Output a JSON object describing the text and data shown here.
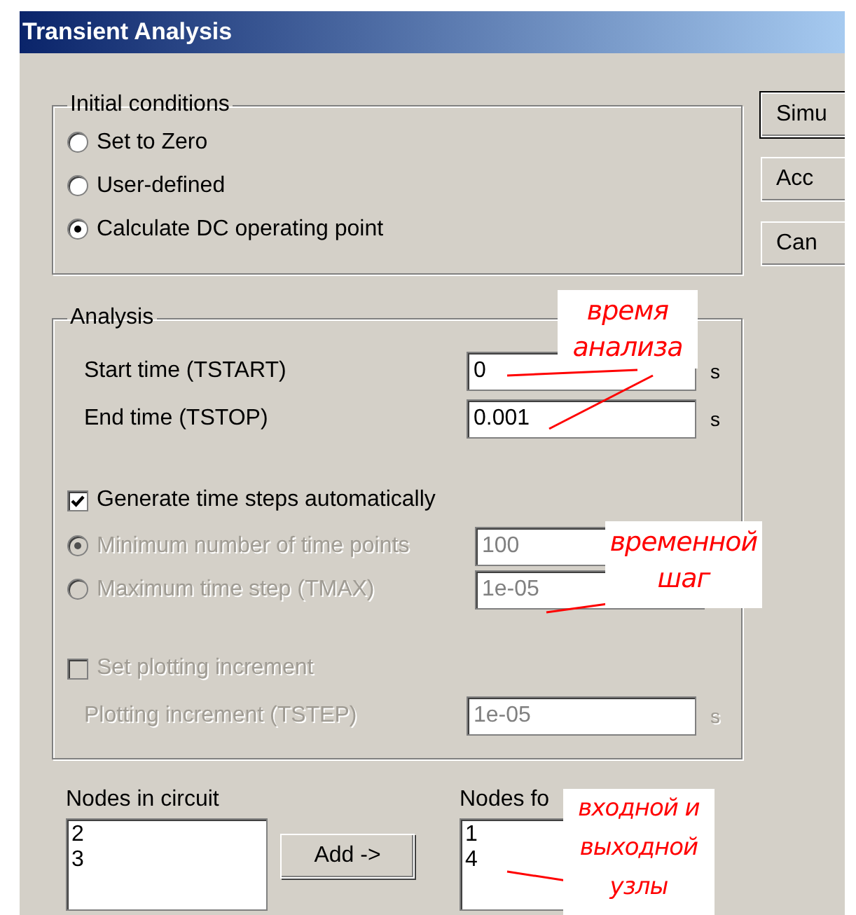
{
  "window": {
    "title": "Transient Analysis"
  },
  "initial_conditions": {
    "title": "Initial conditions",
    "options": [
      {
        "label": "Set to Zero",
        "selected": false
      },
      {
        "label": "User-defined",
        "selected": false
      },
      {
        "label": "Calculate DC operating point",
        "selected": true
      }
    ]
  },
  "buttons": [
    "Simu",
    "Acc",
    "Can"
  ],
  "analysis": {
    "title": "Analysis",
    "rows": [
      {
        "kind": "field",
        "label": "Start time (TSTART)",
        "value": "0",
        "unit": "s",
        "disabled": false
      },
      {
        "kind": "field",
        "label": "End time (TSTOP)",
        "value": "0.001",
        "unit": "s",
        "disabled": false
      },
      {
        "kind": "checkbox",
        "label": "Generate time steps automatically",
        "checked": true,
        "disabled": false
      },
      {
        "kind": "radio-field",
        "label": "Minimum number of time points",
        "selected": true,
        "value": "100",
        "disabled": true
      },
      {
        "kind": "radio-field",
        "label": "Maximum time step (TMAX)",
        "selected": false,
        "value": "1e-05",
        "disabled": true
      },
      {
        "kind": "checkbox",
        "label": "Set plotting increment",
        "checked": false,
        "disabled": true
      },
      {
        "kind": "field",
        "label": "Plotting increment (TSTEP)",
        "value": "1e-05",
        "unit": "s",
        "disabled": true
      }
    ]
  },
  "nodes_in_circuit": {
    "label": "Nodes in circuit",
    "items": [
      "2",
      "3"
    ]
  },
  "add_button": "Add ->",
  "nodes_for": {
    "label": "Nodes fo",
    "items": [
      "1",
      "4"
    ]
  },
  "annotations": [
    "время анализа",
    "временной шаг",
    "входной и выходной узлы"
  ]
}
